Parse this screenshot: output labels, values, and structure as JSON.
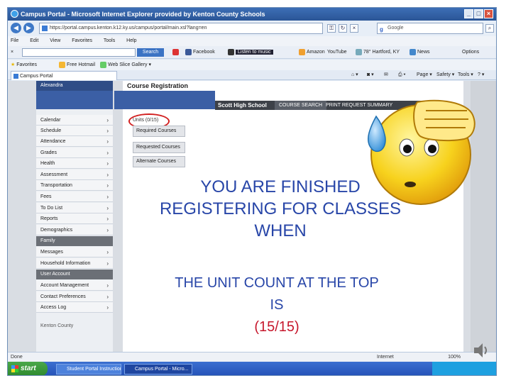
{
  "browser": {
    "title": "Campus Portal - Microsoft Internet Explorer provided by Kenton County Schools",
    "address": "https://portal.campus.kenton.k12.ky.us/campus/portal/main.xsl?lang=en",
    "search_placeholder": "Google",
    "menu": [
      "File",
      "Edit",
      "View",
      "Favorites",
      "Tools",
      "Help"
    ],
    "toolbar": {
      "search_button": "Search",
      "facebook": "Facebook",
      "radio": "Listen to music",
      "amazon": "Amazon",
      "youtube": "YouTube",
      "weather": "78° Hartford, KY",
      "news": "News",
      "options": "Options"
    },
    "favorites": {
      "label": "Favorites",
      "items": [
        "Free Hotmail",
        "Web Slice Gallery"
      ]
    },
    "tab_title": "Campus Portal",
    "commands": [
      "Page",
      "Safety",
      "Tools"
    ],
    "status": {
      "left": "Done",
      "zone": "Internet",
      "zoom": "100%"
    }
  },
  "sidebar": {
    "user_name": "Alexandra",
    "items": [
      {
        "label": "Calendar"
      },
      {
        "label": "Schedule"
      },
      {
        "label": "Attendance"
      },
      {
        "label": "Grades"
      },
      {
        "label": "Health"
      },
      {
        "label": "Assessment"
      },
      {
        "label": "Transportation"
      },
      {
        "label": "Fees"
      },
      {
        "label": "To Do List"
      },
      {
        "label": "Reports"
      },
      {
        "label": "Demographics"
      }
    ],
    "family_header": "Family",
    "family_items": [
      {
        "label": "Messages"
      },
      {
        "label": "Household Information"
      }
    ],
    "account_header": "User Account",
    "account_items": [
      {
        "label": "Account Management"
      },
      {
        "label": "Contact Preferences"
      },
      {
        "label": "Access Log"
      }
    ],
    "footer": "Kenton County"
  },
  "main": {
    "title": "Course Registration",
    "school": "Scott High School",
    "tab_course_search": "COURSE SEARCH",
    "tab_print": "PRINT REQUEST SUMMARY",
    "units": "Units (0/15)",
    "buttons": [
      "Required Courses",
      "Requested Courses",
      "Alternate Courses"
    ]
  },
  "overlay": {
    "line1": "YOU ARE FINISHED",
    "line2": "REGISTERING FOR CLASSES",
    "line3": "WHEN",
    "line4": "THE UNIT COUNT AT THE TOP",
    "line5": "IS",
    "line6": "(15/15)"
  },
  "taskbar": {
    "start": "start",
    "buttons": [
      "Student Portal Instructions",
      "Campus Portal - Micro..."
    ]
  },
  "colors": {
    "overlay_blue": "#2846a8",
    "overlay_red": "#c6172c",
    "nav_blue": "#3b5fa5",
    "circle_red": "#d22020"
  }
}
